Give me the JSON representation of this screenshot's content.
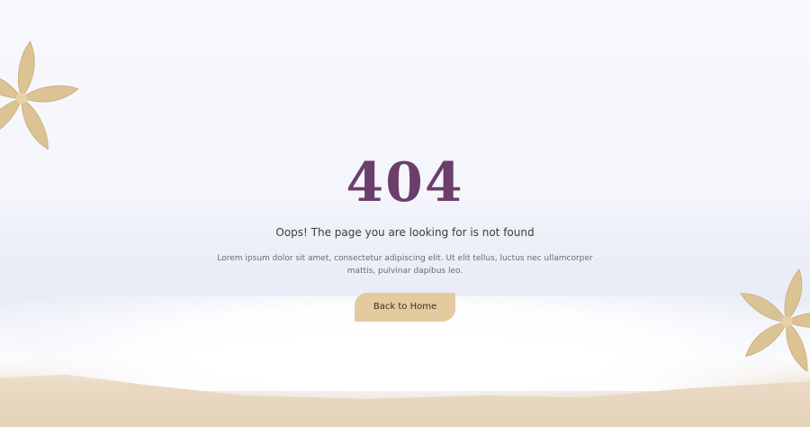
{
  "error": {
    "code": "404",
    "headline": "Oops! The page you are looking for is not found",
    "description": "Lorem ipsum dolor sit amet, consectetur adipiscing elit. Ut elit tellus, luctus nec ullamcorper mattis, pulvinar dapibus leo."
  },
  "actions": {
    "back_home_label": "Back to Home"
  },
  "colors": {
    "accent": "#6c3f6b",
    "button": "#e3ca9f",
    "flower": "#dcc395"
  },
  "icons": {
    "decoration": "flower-icon"
  }
}
